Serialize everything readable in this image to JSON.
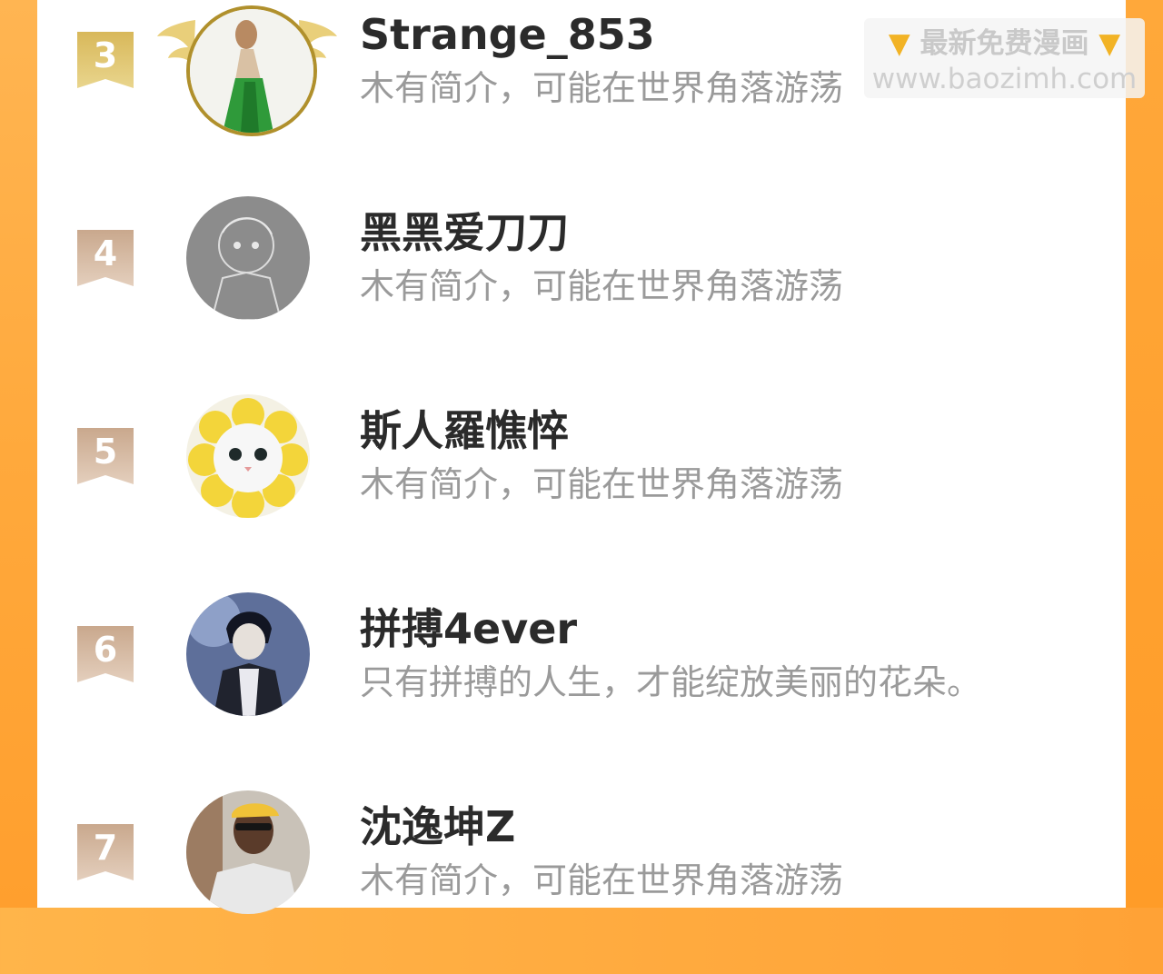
{
  "colors": {
    "gold_ribbon": "#c8a84b",
    "bronze_ribbon": "#cfae92",
    "name_text": "#2b2b2b",
    "bio_text": "#9a9a9a",
    "side_orange": "#ffa236"
  },
  "watermark": {
    "left_icon": "pointing-down-hand-icon",
    "title": "最新免费漫画",
    "right_icon": "pointing-down-hand-icon",
    "url": "www.baozimh.com"
  },
  "ranking": [
    {
      "rank": "3",
      "name": "Strange_853",
      "bio": "木有简介，可能在世界角落游荡",
      "avatar": "girl-in-green-dress-avatar"
    },
    {
      "rank": "4",
      "name": "黑黑爱刀刀",
      "bio": "木有简介，可能在世界角落游荡",
      "avatar": "pencil-sketch-boy-avatar"
    },
    {
      "rank": "5",
      "name": "斯人羅憔悴",
      "bio": "木有简介，可能在世界角落游荡",
      "avatar": "cat-in-sunflower-hat-avatar"
    },
    {
      "rank": "6",
      "name": "拼搏4ever",
      "bio": "只有拼搏的人生，才能绽放美丽的花朵。",
      "avatar": "anime-dark-hair-boy-avatar"
    },
    {
      "rank": "7",
      "name": "沈逸坤Z",
      "bio": "木有简介，可能在世界角落游荡",
      "avatar": "man-in-yellow-cap-avatar"
    }
  ]
}
